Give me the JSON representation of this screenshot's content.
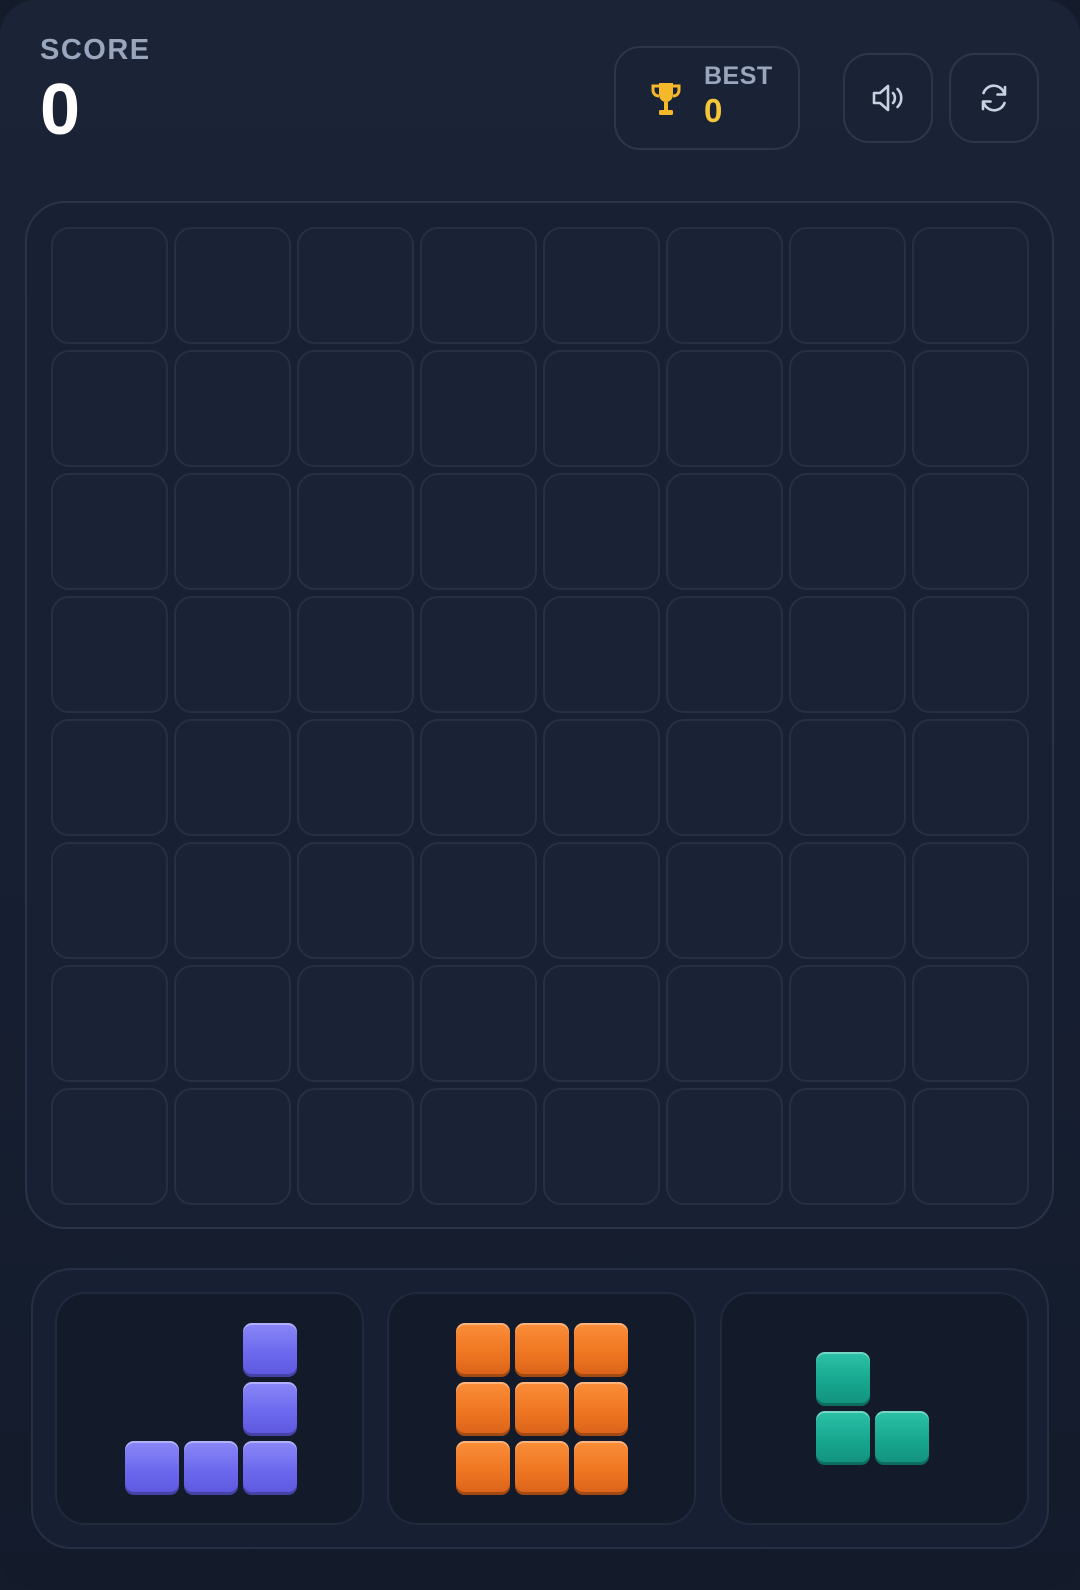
{
  "header": {
    "score_label": "SCORE",
    "score_value": "0",
    "best_label": "BEST",
    "best_value": "0",
    "best_icon": "trophy-icon",
    "sound_icon": "volume-icon",
    "restart_icon": "restart-icon"
  },
  "colors": {
    "background": "#172033",
    "best_value": "#f5c53a",
    "trophy": "#f5b82a",
    "piece_purple": "#6d69ee",
    "piece_orange": "#ef7621",
    "piece_teal": "#17a68f"
  },
  "board": {
    "rows": 8,
    "cols": 8,
    "filled_cells": 0
  },
  "pieces": [
    {
      "name": "j-piece",
      "color": "purple",
      "cells": [
        [
          0,
          2
        ],
        [
          1,
          2
        ],
        [
          2,
          0
        ],
        [
          2,
          1
        ],
        [
          2,
          2
        ]
      ]
    },
    {
      "name": "square-3x3-piece",
      "color": "orange",
      "cells": [
        [
          0,
          0
        ],
        [
          0,
          1
        ],
        [
          0,
          2
        ],
        [
          1,
          0
        ],
        [
          1,
          1
        ],
        [
          1,
          2
        ],
        [
          2,
          0
        ],
        [
          2,
          1
        ],
        [
          2,
          2
        ]
      ]
    },
    {
      "name": "l-small-piece",
      "color": "teal",
      "cells": [
        [
          0,
          0
        ],
        [
          1,
          0
        ],
        [
          1,
          1
        ]
      ]
    }
  ]
}
